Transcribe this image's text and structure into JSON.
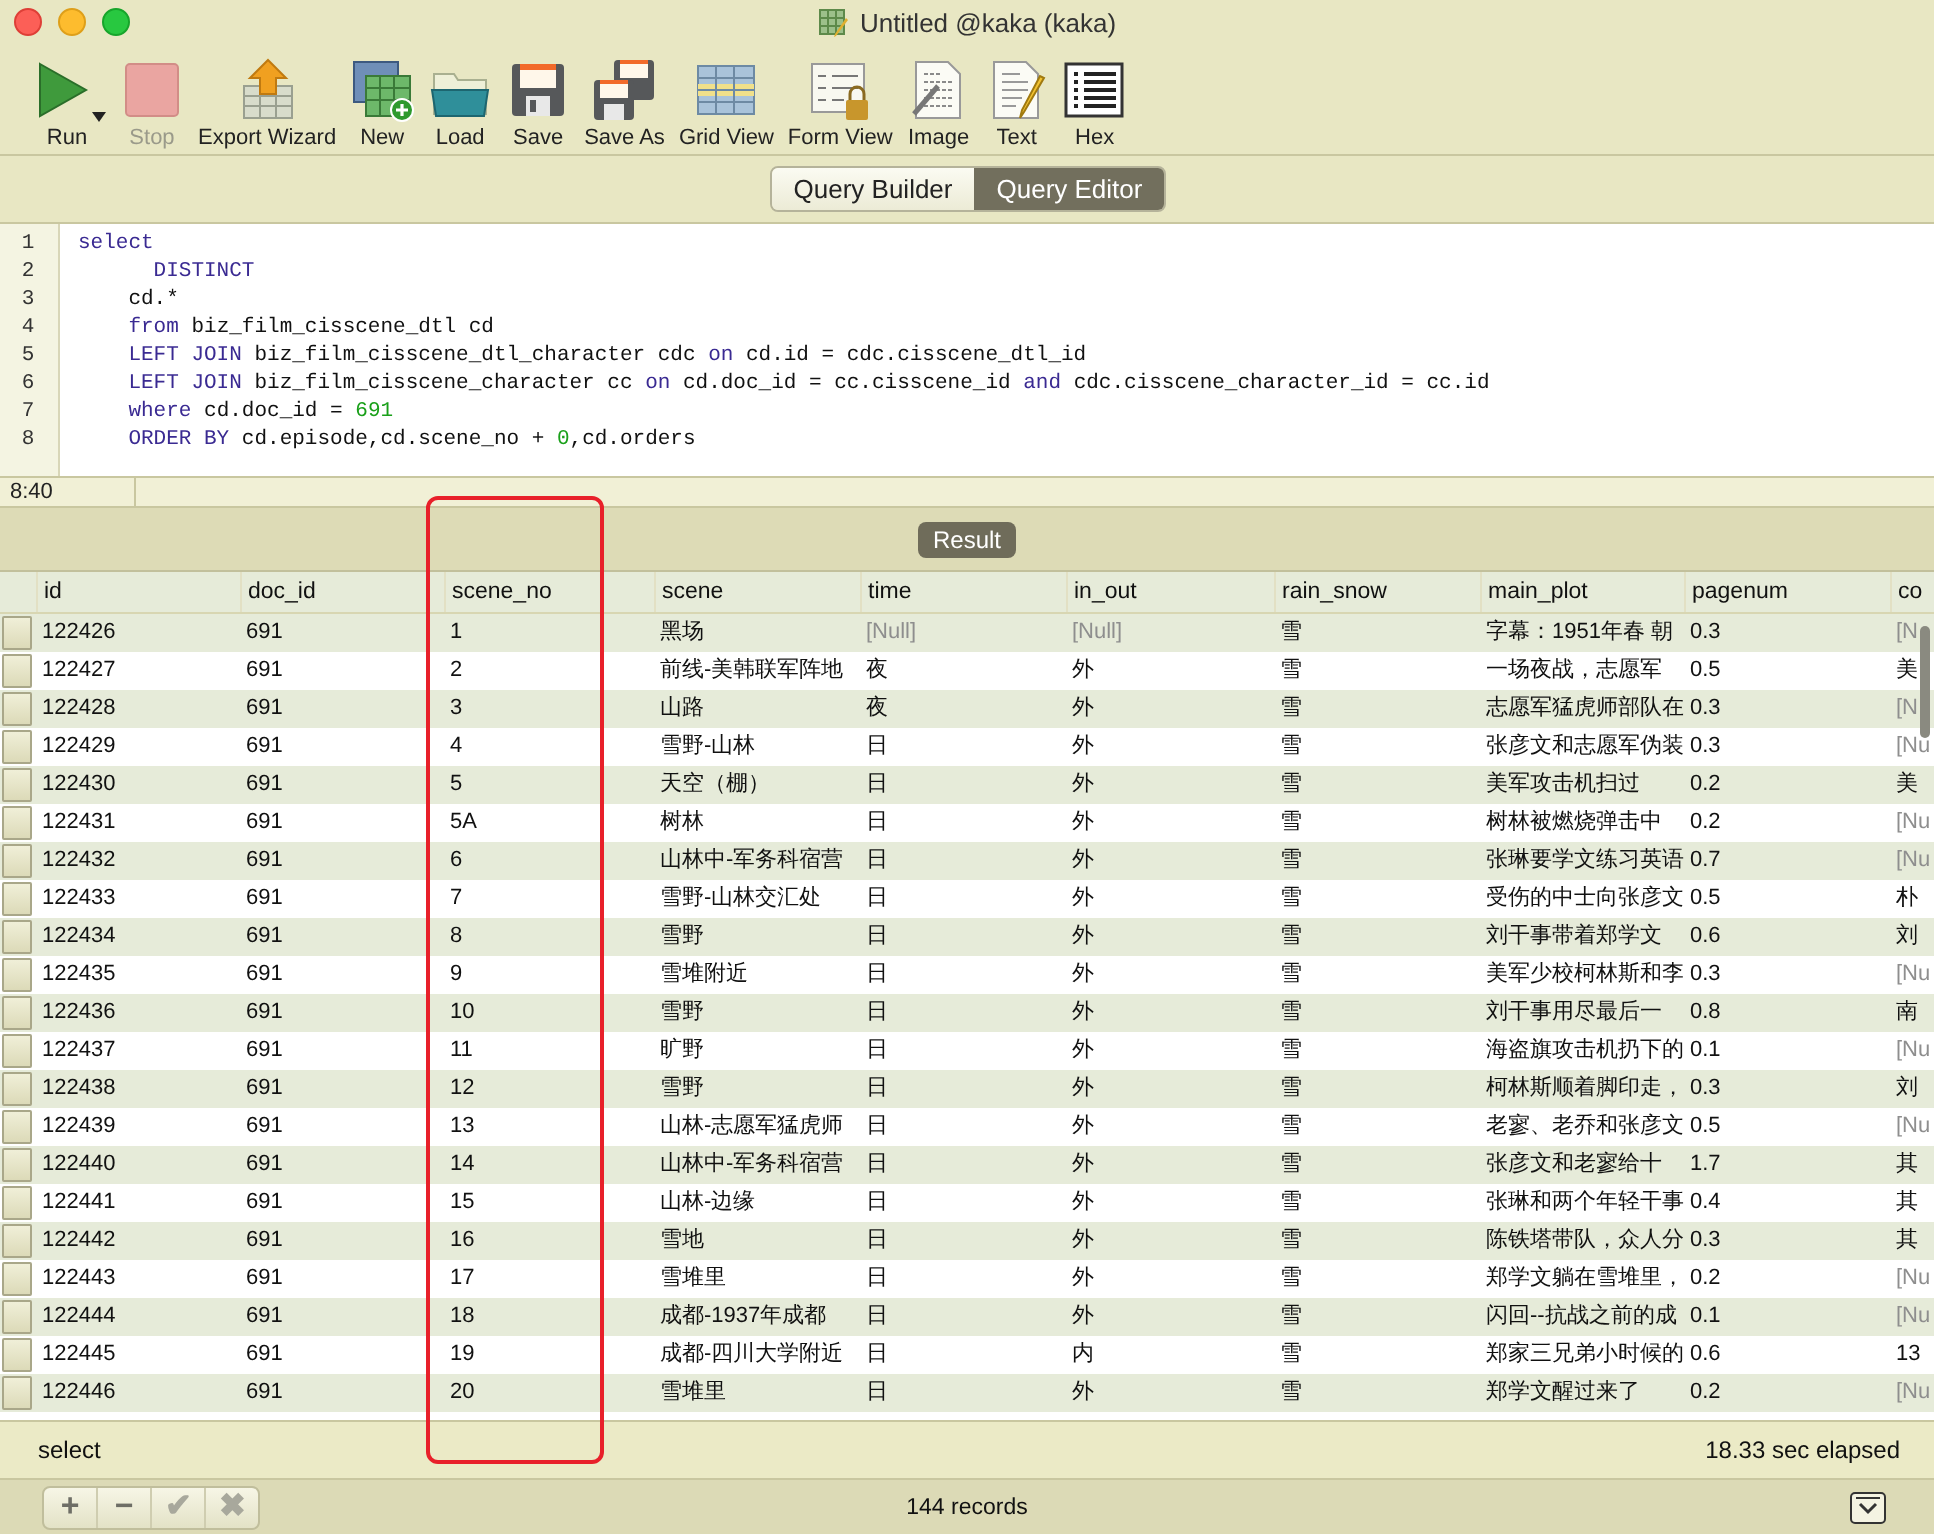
{
  "window": {
    "title": "Untitled @kaka (kaka)"
  },
  "toolbar": [
    {
      "kind": "run",
      "label": "Run",
      "disabled": false,
      "menu": true
    },
    {
      "kind": "stop",
      "label": "Stop",
      "disabled": true,
      "menu": false
    },
    {
      "kind": "export",
      "label": "Export Wizard",
      "disabled": false,
      "menu": false
    },
    {
      "kind": "new",
      "label": "New",
      "disabled": false,
      "menu": false
    },
    {
      "kind": "load",
      "label": "Load",
      "disabled": false,
      "menu": false
    },
    {
      "kind": "save",
      "label": "Save",
      "disabled": false,
      "menu": false
    },
    {
      "kind": "saveas",
      "label": "Save As",
      "disabled": false,
      "menu": false
    },
    {
      "kind": "grid",
      "label": "Grid View",
      "disabled": false,
      "menu": false
    },
    {
      "kind": "form",
      "label": "Form View",
      "disabled": false,
      "menu": false
    },
    {
      "kind": "image",
      "label": "Image",
      "disabled": false,
      "menu": false
    },
    {
      "kind": "text",
      "label": "Text",
      "disabled": false,
      "menu": false
    },
    {
      "kind": "hex",
      "label": "Hex",
      "disabled": false,
      "menu": false
    }
  ],
  "view_tabs": [
    {
      "label": "Query Builder",
      "selected": false
    },
    {
      "label": "Query Editor",
      "selected": true
    }
  ],
  "editor": {
    "lines": [
      {
        "number": "1",
        "tokens": [
          {
            "kind": "keyword",
            "text": "select"
          }
        ]
      },
      {
        "number": "2",
        "tokens": [
          {
            "kind": "keyword",
            "text": "      DISTINCT"
          }
        ]
      },
      {
        "number": "3",
        "tokens": [
          {
            "kind": "plain",
            "text": "    cd.*"
          }
        ]
      },
      {
        "number": "4",
        "tokens": [
          {
            "kind": "keyword",
            "text": "    from"
          },
          {
            "kind": "plain",
            "text": " biz_film_cisscene_dtl cd"
          }
        ]
      },
      {
        "number": "5",
        "tokens": [
          {
            "kind": "keyword",
            "text": "    LEFT JOIN"
          },
          {
            "kind": "plain",
            "text": " biz_film_cisscene_dtl_character cdc "
          },
          {
            "kind": "keyword",
            "text": "on"
          },
          {
            "kind": "plain",
            "text": " cd.id = cdc.cisscene_dtl_id"
          }
        ]
      },
      {
        "number": "6",
        "tokens": [
          {
            "kind": "keyword",
            "text": "    LEFT JOIN"
          },
          {
            "kind": "plain",
            "text": " biz_film_cisscene_character cc "
          },
          {
            "kind": "keyword",
            "text": "on"
          },
          {
            "kind": "plain",
            "text": " cd.doc_id = cc.cisscene_id "
          },
          {
            "kind": "keyword",
            "text": "and"
          },
          {
            "kind": "plain",
            "text": " cdc.cisscene_character_id = cc.id"
          }
        ]
      },
      {
        "number": "7",
        "tokens": [
          {
            "kind": "keyword",
            "text": "    where"
          },
          {
            "kind": "plain",
            "text": " cd.doc_id = "
          },
          {
            "kind": "number",
            "text": "691"
          }
        ]
      },
      {
        "number": "8",
        "tokens": [
          {
            "kind": "keyword",
            "text": "    ORDER BY"
          },
          {
            "kind": "plain",
            "text": " cd.episode,cd.scene_no + "
          },
          {
            "kind": "number",
            "text": "0"
          },
          {
            "kind": "plain",
            "text": ",cd.orders"
          }
        ]
      }
    ],
    "cursor_position": "8:40"
  },
  "result": {
    "title": "Result",
    "columns": [
      "id",
      "doc_id",
      "scene_no",
      "scene",
      "time",
      "in_out",
      "rain_snow",
      "main_plot",
      "pagenum",
      "co"
    ],
    "rows": [
      {
        "cells": [
          "122426",
          "691",
          "1",
          "黑场",
          {
            "text": "[Null]",
            "null": true
          },
          {
            "text": "[Null]",
            "null": true
          },
          "雪",
          "字幕：1951年春 朝",
          "0.3",
          {
            "text": "[N",
            "null": true
          }
        ]
      },
      {
        "cells": [
          "122427",
          "691",
          "2",
          "前线-美韩联军阵地",
          "夜",
          "外",
          "雪",
          "一场夜战，志愿军",
          "0.5",
          "美"
        ]
      },
      {
        "cells": [
          "122428",
          "691",
          "3",
          "山路",
          "夜",
          "外",
          "雪",
          "志愿军猛虎师部队在",
          "0.3",
          {
            "text": "[N",
            "null": true
          }
        ]
      },
      {
        "cells": [
          "122429",
          "691",
          "4",
          "雪野-山林",
          "日",
          "外",
          "雪",
          "张彦文和志愿军伪装",
          "0.3",
          {
            "text": "[Nu",
            "null": true
          }
        ]
      },
      {
        "cells": [
          "122430",
          "691",
          "5",
          "天空（棚）",
          "日",
          "外",
          "雪",
          "美军攻击机扫过",
          "0.2",
          "美"
        ]
      },
      {
        "cells": [
          "122431",
          "691",
          "5A",
          "树林",
          "日",
          "外",
          "雪",
          "树林被燃烧弹击中",
          "0.2",
          {
            "text": "[Nu",
            "null": true
          }
        ]
      },
      {
        "cells": [
          "122432",
          "691",
          "6",
          "山林中-军务科宿营",
          "日",
          "外",
          "雪",
          "张琳要学文练习英语",
          "0.7",
          {
            "text": "[Nu",
            "null": true
          }
        ]
      },
      {
        "cells": [
          "122433",
          "691",
          "7",
          "雪野-山林交汇处",
          "日",
          "外",
          "雪",
          "受伤的中士向张彦文",
          "0.5",
          "朴"
        ]
      },
      {
        "cells": [
          "122434",
          "691",
          "8",
          "雪野",
          "日",
          "外",
          "雪",
          "刘干事带着郑学文",
          "0.6",
          "刘"
        ]
      },
      {
        "cells": [
          "122435",
          "691",
          "9",
          "雪堆附近",
          "日",
          "外",
          "雪",
          "美军少校柯林斯和李",
          "0.3",
          {
            "text": "[Nu",
            "null": true
          }
        ]
      },
      {
        "cells": [
          "122436",
          "691",
          "10",
          "雪野",
          "日",
          "外",
          "雪",
          "刘干事用尽最后一",
          "0.8",
          "南"
        ]
      },
      {
        "cells": [
          "122437",
          "691",
          "11",
          "旷野",
          "日",
          "外",
          "雪",
          "海盗旗攻击机扔下的",
          "0.1",
          {
            "text": "[Nu",
            "null": true
          }
        ]
      },
      {
        "cells": [
          "122438",
          "691",
          "12",
          "雪野",
          "日",
          "外",
          "雪",
          "柯林斯顺着脚印走，",
          "0.3",
          "刘"
        ]
      },
      {
        "cells": [
          "122439",
          "691",
          "13",
          "山林-志愿军猛虎师",
          "日",
          "外",
          "雪",
          "老寥、老乔和张彦文",
          "0.5",
          {
            "text": "[Nu",
            "null": true
          }
        ]
      },
      {
        "cells": [
          "122440",
          "691",
          "14",
          "山林中-军务科宿营",
          "日",
          "外",
          "雪",
          "张彦文和老寥给十",
          "1.7",
          "其"
        ]
      },
      {
        "cells": [
          "122441",
          "691",
          "15",
          "山林-边缘",
          "日",
          "外",
          "雪",
          "张琳和两个年轻干事",
          "0.4",
          "其"
        ]
      },
      {
        "cells": [
          "122442",
          "691",
          "16",
          "雪地",
          "日",
          "外",
          "雪",
          "陈铁塔带队，众人分",
          "0.3",
          "其"
        ]
      },
      {
        "cells": [
          "122443",
          "691",
          "17",
          "雪堆里",
          "日",
          "外",
          "雪",
          "郑学文躺在雪堆里，",
          "0.2",
          {
            "text": "[Nu",
            "null": true
          }
        ]
      },
      {
        "cells": [
          "122444",
          "691",
          "18",
          "成都-1937年成都",
          "日",
          "外",
          "雪",
          "闪回--抗战之前的成",
          "0.1",
          {
            "text": "[Nu",
            "null": true
          }
        ]
      },
      {
        "cells": [
          "122445",
          "691",
          "19",
          "成都-四川大学附近",
          "日",
          "内",
          "雪",
          "郑家三兄弟小时候的",
          "0.6",
          "13"
        ]
      },
      {
        "cells": [
          "122446",
          "691",
          "20",
          "雪堆里",
          "日",
          "外",
          "雪",
          "郑学文醒过来了",
          "0.2",
          {
            "text": "[Nu",
            "null": true
          }
        ]
      }
    ]
  },
  "status": {
    "message": "select",
    "elapsed": "18.33 sec elapsed"
  },
  "footer": {
    "buttons": [
      {
        "symbol": "+",
        "disabled": false
      },
      {
        "symbol": "−",
        "disabled": false
      },
      {
        "symbol": "✔",
        "disabled": true
      },
      {
        "symbol": "✖",
        "disabled": true
      }
    ],
    "record_count": "144 records"
  }
}
